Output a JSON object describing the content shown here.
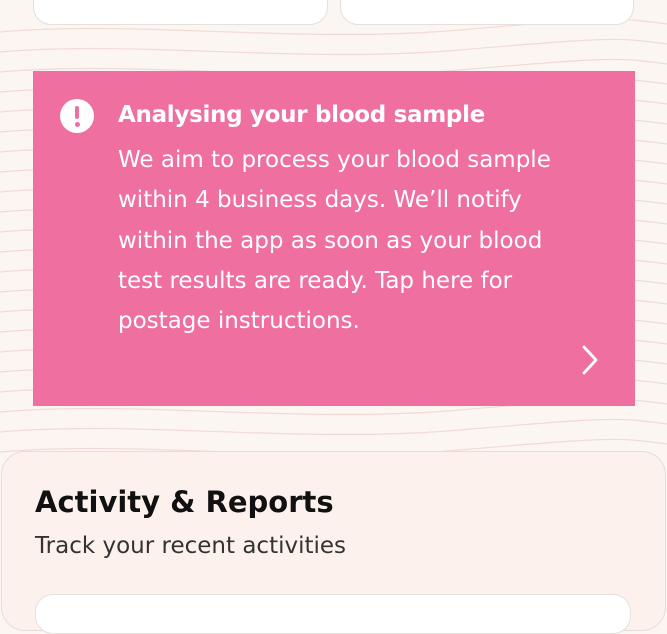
{
  "banner": {
    "title": "Analysing your blood sample",
    "body": "We aim to process your blood sample within 4 business days. We’ll notify within the app as soon as your blood test results are ready. Tap here for postage instructions.",
    "icon": "alert-icon",
    "chevron_icon": "chevron-right-icon",
    "background_color": "#ef6fa0"
  },
  "activity": {
    "title": "Activity & Reports",
    "subtitle": "Track your recent activities"
  }
}
